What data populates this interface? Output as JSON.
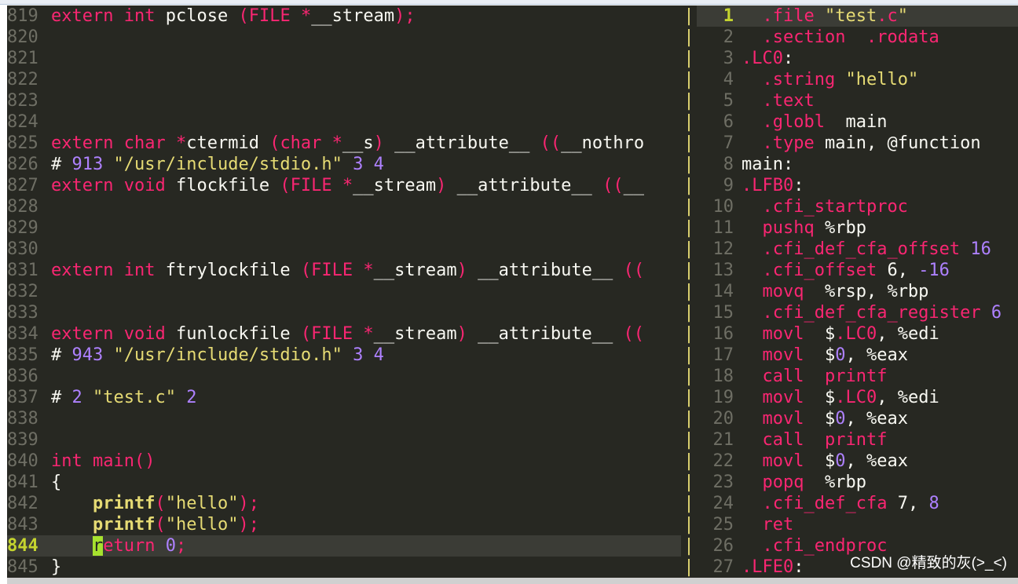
{
  "left_pane": {
    "lines": [
      {
        "num": "819",
        "text": "extern int pclose (FILE *__stream);"
      },
      {
        "num": "820",
        "text": ""
      },
      {
        "num": "821",
        "text": ""
      },
      {
        "num": "822",
        "text": ""
      },
      {
        "num": "823",
        "text": ""
      },
      {
        "num": "824",
        "text": ""
      },
      {
        "num": "825",
        "text": "extern char *ctermid (char *__s) __attribute__ ((__nothro"
      },
      {
        "num": "826",
        "text": "# 913 \"/usr/include/stdio.h\" 3 4"
      },
      {
        "num": "827",
        "text": "extern void flockfile (FILE *__stream) __attribute__ ((__"
      },
      {
        "num": "828",
        "text": ""
      },
      {
        "num": "829",
        "text": ""
      },
      {
        "num": "830",
        "text": ""
      },
      {
        "num": "831",
        "text": "extern int ftrylockfile (FILE *__stream) __attribute__ (("
      },
      {
        "num": "832",
        "text": ""
      },
      {
        "num": "833",
        "text": ""
      },
      {
        "num": "834",
        "text": "extern void funlockfile (FILE *__stream) __attribute__ (("
      },
      {
        "num": "835",
        "text": "# 943 \"/usr/include/stdio.h\" 3 4"
      },
      {
        "num": "836",
        "text": ""
      },
      {
        "num": "837",
        "text": "# 2 \"test.c\" 2"
      },
      {
        "num": "838",
        "text": ""
      },
      {
        "num": "839",
        "text": ""
      },
      {
        "num": "840",
        "text": "int main()"
      },
      {
        "num": "841",
        "text": "{"
      },
      {
        "num": "842",
        "text": "    printf(\"hello\");"
      },
      {
        "num": "843",
        "text": "    printf(\"hello\");"
      },
      {
        "num": "844",
        "text": "    return 0;"
      },
      {
        "num": "845",
        "text": "}"
      }
    ]
  },
  "right_pane": {
    "lines": [
      {
        "num": "1",
        "text": "  .file \"test.c\""
      },
      {
        "num": "2",
        "text": "  .section  .rodata"
      },
      {
        "num": "3",
        "text": ".LC0:"
      },
      {
        "num": "4",
        "text": "  .string \"hello\""
      },
      {
        "num": "5",
        "text": "  .text"
      },
      {
        "num": "6",
        "text": "  .globl  main"
      },
      {
        "num": "7",
        "text": "  .type main, @function"
      },
      {
        "num": "8",
        "text": "main:"
      },
      {
        "num": "9",
        "text": ".LFB0:"
      },
      {
        "num": "10",
        "text": "  .cfi_startproc"
      },
      {
        "num": "11",
        "text": "  pushq %rbp"
      },
      {
        "num": "12",
        "text": "  .cfi_def_cfa_offset 16"
      },
      {
        "num": "13",
        "text": "  .cfi_offset 6, -16"
      },
      {
        "num": "14",
        "text": "  movq  %rsp, %rbp"
      },
      {
        "num": "15",
        "text": "  .cfi_def_cfa_register 6"
      },
      {
        "num": "16",
        "text": "  movl  $.LC0, %edi"
      },
      {
        "num": "17",
        "text": "  movl  $0, %eax"
      },
      {
        "num": "18",
        "text": "  call  printf"
      },
      {
        "num": "19",
        "text": "  movl  $.LC0, %edi"
      },
      {
        "num": "20",
        "text": "  movl  $0, %eax"
      },
      {
        "num": "21",
        "text": "  call  printf"
      },
      {
        "num": "22",
        "text": "  movl  $0, %eax"
      },
      {
        "num": "23",
        "text": "  popq  %rbp"
      },
      {
        "num": "24",
        "text": "  .cfi_def_cfa 7, 8"
      },
      {
        "num": "25",
        "text": "  ret"
      },
      {
        "num": "26",
        "text": "  .cfi_endproc"
      },
      {
        "num": "27",
        "text": ".LFE0:"
      }
    ]
  },
  "current_left_line": "844",
  "current_right_line": "1",
  "watermark": "CSDN @精致的灰(>_<)",
  "colors": {
    "background": "#272822",
    "keyword": "#f92672",
    "string": "#e6db74",
    "number": "#ae81ff",
    "function": "#a6e22e",
    "linenumber": "#6e6e64",
    "current_linenumber": "#c4d42e"
  }
}
